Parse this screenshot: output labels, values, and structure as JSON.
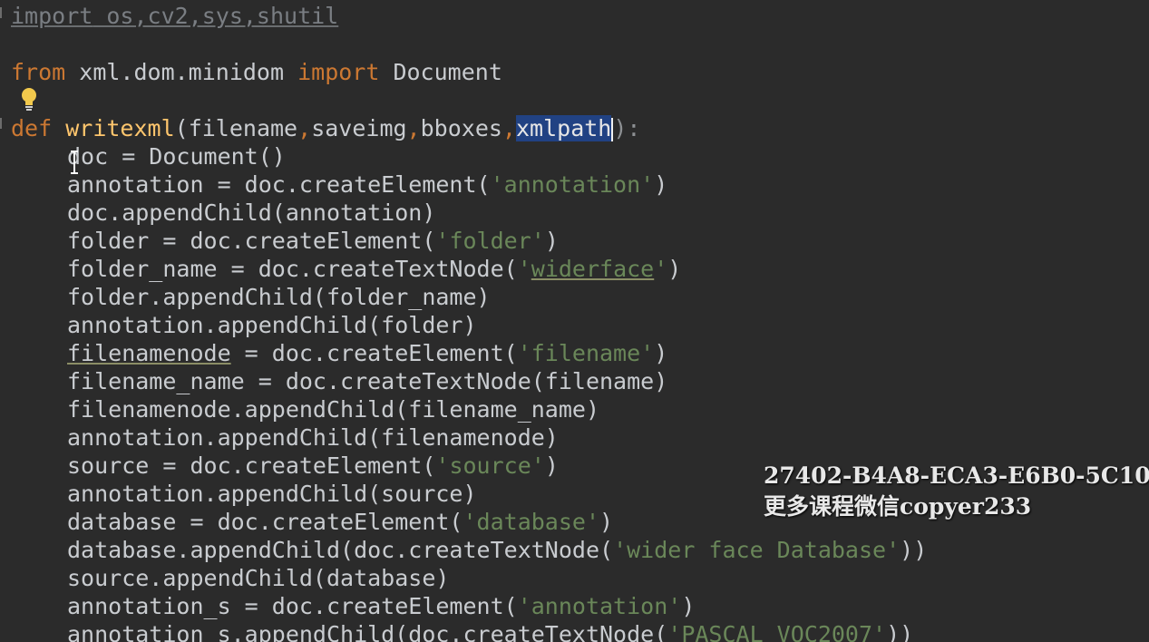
{
  "editor": {
    "colors": {
      "background": "#2b2b2b",
      "keyword": "#cc7832",
      "function_name": "#ffc66d",
      "string": "#6a8759",
      "plain": "#c9ccd0",
      "selection": "#214283"
    },
    "line1": {
      "kw": "import",
      "rest": " os,cv2,sys,shutil"
    },
    "line3": {
      "kw1": "from",
      "mod": " xml.dom.minidom ",
      "kw2": "import",
      "rest": " Document"
    },
    "line5": {
      "kw": "def",
      "name": "writexml",
      "p_open": "(",
      "p1": "filename",
      "c1": ",",
      "p2": "saveimg",
      "c2": ",",
      "p3": "bboxes",
      "c3": ",",
      "p4": "xmlpath",
      "p_close": ")",
      "colon": ":"
    },
    "body": [
      {
        "code": "doc = Document()"
      },
      {
        "pre": "annotation = doc.createElement(",
        "str": "'annotation'",
        "post": ")"
      },
      {
        "code": "doc.appendChild(annotation)"
      },
      {
        "pre": "folder = doc.createElement(",
        "str": "'folder'",
        "post": ")"
      },
      {
        "pre": "folder_name = doc.createTextNode(",
        "str_q1": "'",
        "str_sq": "widerface",
        "str_q2": "'",
        "post": ")"
      },
      {
        "code": "folder.appendChild(folder_name)"
      },
      {
        "code": "annotation.appendChild(folder)"
      },
      {
        "sq": "filenamenode",
        "pre": " = doc.createElement(",
        "str": "'filename'",
        "post": ")"
      },
      {
        "code": "filename_name = doc.createTextNode(filename)"
      },
      {
        "code": "filenamenode.appendChild(filename_name)"
      },
      {
        "code": "annotation.appendChild(filenamenode)"
      },
      {
        "pre": "source = doc.createElement(",
        "str": "'source'",
        "post": ")"
      },
      {
        "code": "annotation.appendChild(source)"
      },
      {
        "pre": "database = doc.createElement(",
        "str": "'database'",
        "post": ")"
      },
      {
        "pre": "database.appendChild(doc.createTextNode(",
        "str": "'wider face Database'",
        "post": "))"
      },
      {
        "code": "source.appendChild(database)"
      },
      {
        "pre": "annotation_s = doc.createElement(",
        "str": "'annotation'",
        "post": ")"
      },
      {
        "pre": "annotation_s.appendChild(doc.createTextNode(",
        "str": "'PASCAL VOC2007'",
        "post": "))"
      }
    ]
  },
  "icons": {
    "fold_marker": "fold-marker-icon",
    "intention_bulb": "lightbulb-icon",
    "mouse_cursor": "ibeam-cursor-icon"
  },
  "watermark": {
    "line1": "27402-B4A8-ECA3-E6B0-5C10",
    "line2": "更多课程微信copyer233"
  }
}
